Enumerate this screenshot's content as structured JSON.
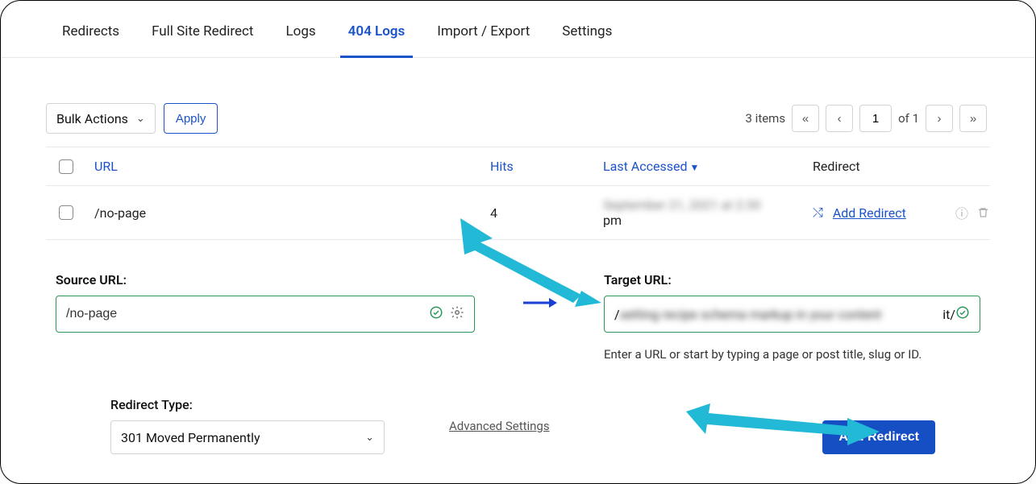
{
  "tabs": {
    "redirects": "Redirects",
    "full_site": "Full Site Redirect",
    "logs": "Logs",
    "404_logs": "404 Logs",
    "import_export": "Import / Export",
    "settings": "Settings"
  },
  "toolbar": {
    "bulk_actions_label": "Bulk Actions",
    "apply_label": "Apply"
  },
  "pager": {
    "items_text": "3 items",
    "page": "1",
    "of_text": "of 1"
  },
  "table": {
    "headers": {
      "url": "URL",
      "hits": "Hits",
      "last_accessed": "Last Accessed",
      "redirect": "Redirect"
    },
    "row": {
      "url": "/no-page",
      "hits": "4",
      "last_accessed_hidden": "September 21, 2021 at 2:30",
      "last_accessed_suffix": "pm",
      "add_redirect_label": "Add Redirect"
    }
  },
  "form": {
    "source_label": "Source URL:",
    "source_value": "/no-page",
    "target_label": "Target URL:",
    "target_value_prefix": "/",
    "target_value_hidden": "setting recipe schema markup in your content",
    "target_value_suffix": "it/",
    "target_helper": "Enter a URL or start by typing a page or post title, slug or ID.",
    "redirect_type_label": "Redirect Type:",
    "redirect_type_value": "301 Moved Permanently",
    "advanced_settings": "Advanced Settings",
    "add_redirect_button": "Add Redirect"
  },
  "icons": {
    "shuffle": "⤭"
  }
}
